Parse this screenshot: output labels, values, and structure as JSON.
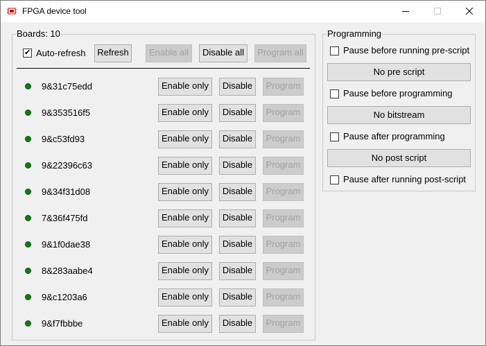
{
  "window": {
    "title": "FPGA device tool",
    "icon": "chip-icon",
    "controls": [
      "minimize-icon",
      "maximize-icon",
      "close-icon"
    ]
  },
  "boards_group": {
    "legend": "Boards: 10",
    "auto_refresh": {
      "label": "Auto-refresh",
      "checked": true
    },
    "buttons": {
      "refresh": "Refresh",
      "enable_all": "Enable all",
      "disable_all": "Disable all",
      "program_all": "Program all"
    },
    "row_buttons": {
      "enable_only": "Enable only",
      "disable": "Disable",
      "program": "Program"
    },
    "boards": [
      {
        "id": "9&31c75edd",
        "status_color": "#107c10"
      },
      {
        "id": "9&353516f5",
        "status_color": "#107c10"
      },
      {
        "id": "9&c53fd93",
        "status_color": "#107c10"
      },
      {
        "id": "9&22396c63",
        "status_color": "#107c10"
      },
      {
        "id": "9&34f31d08",
        "status_color": "#107c10"
      },
      {
        "id": "7&36f475fd",
        "status_color": "#107c10"
      },
      {
        "id": "9&1f0dae38",
        "status_color": "#107c10"
      },
      {
        "id": "8&283aabe4",
        "status_color": "#107c10"
      },
      {
        "id": "9&c1203a6",
        "status_color": "#107c10"
      },
      {
        "id": "9&f7fbbbe",
        "status_color": "#107c10"
      }
    ]
  },
  "programming_group": {
    "legend": "Programming",
    "pause_pre_script": {
      "label": "Pause before running pre-script",
      "checked": false
    },
    "pre_script_button": "No pre script",
    "pause_before_programming": {
      "label": "Pause before programming",
      "checked": false
    },
    "bitstream_button": "No bitstream",
    "pause_after_programming": {
      "label": "Pause after programming",
      "checked": false
    },
    "post_script_button": "No post script",
    "pause_post_script": {
      "label": "Pause after running post-script",
      "checked": false
    }
  }
}
